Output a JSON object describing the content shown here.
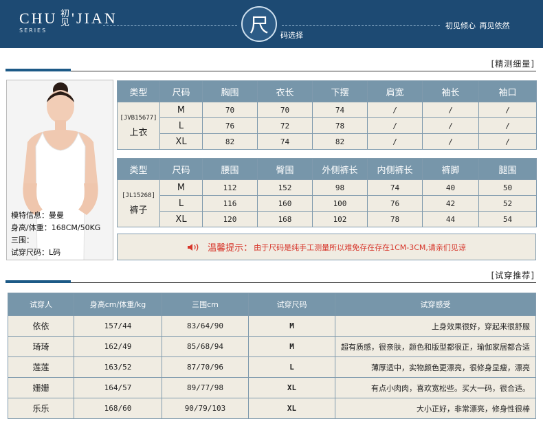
{
  "banner": {
    "brand_left": "CHU",
    "brand_cn": "初见",
    "brand_right": "'JIAN",
    "series": "SERIES",
    "circle_char": "尺",
    "size_select": "码选择",
    "slogan": "初见倾心  再见依然"
  },
  "section1": {
    "title": "[精测细量]"
  },
  "section2": {
    "title": "[试穿推荐]"
  },
  "model": {
    "line1": "模特信息：曼曼",
    "line2": "身高/体重：168CM/50KG",
    "line3": "三围：",
    "line4": "试穿尺码：L码"
  },
  "tops": {
    "headers": [
      "类型",
      "尺码",
      "胸围",
      "衣长",
      "下摆",
      "肩宽",
      "袖长",
      "袖口"
    ],
    "code": "[JVB15677]",
    "name": "上衣",
    "rows": [
      {
        "size": "M",
        "vals": [
          "70",
          "70",
          "74",
          "/",
          "/",
          "/"
        ]
      },
      {
        "size": "L",
        "vals": [
          "76",
          "72",
          "78",
          "/",
          "/",
          "/"
        ]
      },
      {
        "size": "XL",
        "vals": [
          "82",
          "74",
          "82",
          "/",
          "/",
          "/"
        ]
      }
    ]
  },
  "pants": {
    "headers": [
      "类型",
      "尺码",
      "腰围",
      "臀围",
      "外侧裤长",
      "内侧裤长",
      "裤脚",
      "腿围"
    ],
    "code": "[JL15268]",
    "name": "裤子",
    "rows": [
      {
        "size": "M",
        "vals": [
          "112",
          "152",
          "98",
          "74",
          "40",
          "50"
        ]
      },
      {
        "size": "L",
        "vals": [
          "116",
          "160",
          "100",
          "76",
          "42",
          "52"
        ]
      },
      {
        "size": "XL",
        "vals": [
          "120",
          "168",
          "102",
          "78",
          "44",
          "54"
        ]
      }
    ]
  },
  "tip": {
    "label": "温馨提示：",
    "text": "由于尺码是纯手工测量所以难免存在存在1CM-3CM,请亲们见谅"
  },
  "tryon": {
    "headers": [
      "试穿人",
      "身高cm/体重/kg",
      "三围cm",
      "试穿尺码",
      "试穿感受"
    ],
    "rows": [
      {
        "name": "依依",
        "hw": "157/44",
        "bust": "83/64/90",
        "size": "M",
        "feel": "上身效果很好，穿起来很舒服"
      },
      {
        "name": "琦琦",
        "hw": "162/49",
        "bust": "85/68/94",
        "size": "M",
        "feel": "超有质感，很亲肤，颜色和版型都很正，瑜伽家居都合适"
      },
      {
        "name": "莲莲",
        "hw": "163/52",
        "bust": "87/70/96",
        "size": "L",
        "feel": "薄厚适中，实物颜色更漂亮，很修身显瘦，漂亮"
      },
      {
        "name": "姗姗",
        "hw": "164/57",
        "bust": "89/77/98",
        "size": "XL",
        "feel": "有点小肉肉，喜欢宽松些。买大一码，很合适。"
      },
      {
        "name": "乐乐",
        "hw": "168/60",
        "bust": "90/79/103",
        "size": "XL",
        "feel": "大小正好，非常漂亮，修身性很棒"
      }
    ]
  },
  "colors": {
    "banner": "#1d4a73",
    "header_cell": "#7796aa",
    "cell_bg": "#f0ece2",
    "tip_text": "#d7362b"
  }
}
